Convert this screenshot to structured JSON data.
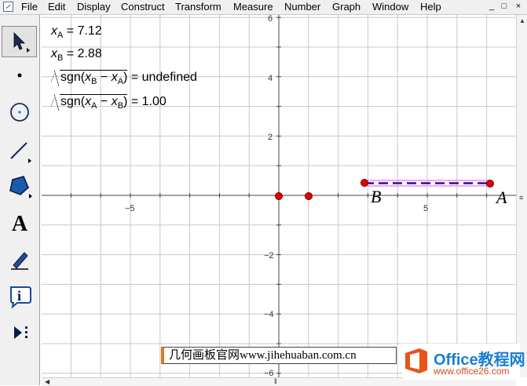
{
  "menu": [
    "File",
    "Edit",
    "Display",
    "Construct",
    "Transform",
    "Measure",
    "Number",
    "Graph",
    "Window",
    "Help"
  ],
  "window_buttons": [
    "_",
    "□",
    "×"
  ],
  "tools": [
    {
      "name": "arrow-select-tool",
      "icon": "arrow-icon"
    },
    {
      "name": "point-tool",
      "icon": "point-icon"
    },
    {
      "name": "compass-tool",
      "icon": "circle-compass-icon"
    },
    {
      "name": "straightedge-tool",
      "icon": "segment-icon"
    },
    {
      "name": "polygon-tool",
      "icon": "polygon-icon"
    },
    {
      "name": "text-tool",
      "icon": "text-A-icon",
      "label": "A"
    },
    {
      "name": "marker-tool",
      "icon": "pen-icon"
    },
    {
      "name": "information-tool",
      "icon": "info-icon",
      "label": "i"
    },
    {
      "name": "custom-tools",
      "icon": "play-more-icon"
    }
  ],
  "measurements": {
    "xa_value": "7.12",
    "xb_value": "2.88",
    "sqrt1_result": "undefined",
    "sqrt2_result": "1.00",
    "fn": "sgn"
  },
  "axes": {
    "x_ticks": [
      "−5",
      "5"
    ],
    "y_ticks": [
      "6",
      "4",
      "2",
      "−2",
      "−4",
      "−6"
    ]
  },
  "points": {
    "A_label": "A",
    "B_label": "B"
  },
  "watermark": "几何画板官网www.jihehuaban.com.cn",
  "logo": {
    "title": "Office教程网",
    "url": "www.office26.com"
  },
  "colors": {
    "grid": "#c8c8c8",
    "point_fill": "#e00000",
    "segment_highlight": "#ff80ff",
    "segment_dash": "#1a1a7a"
  }
}
